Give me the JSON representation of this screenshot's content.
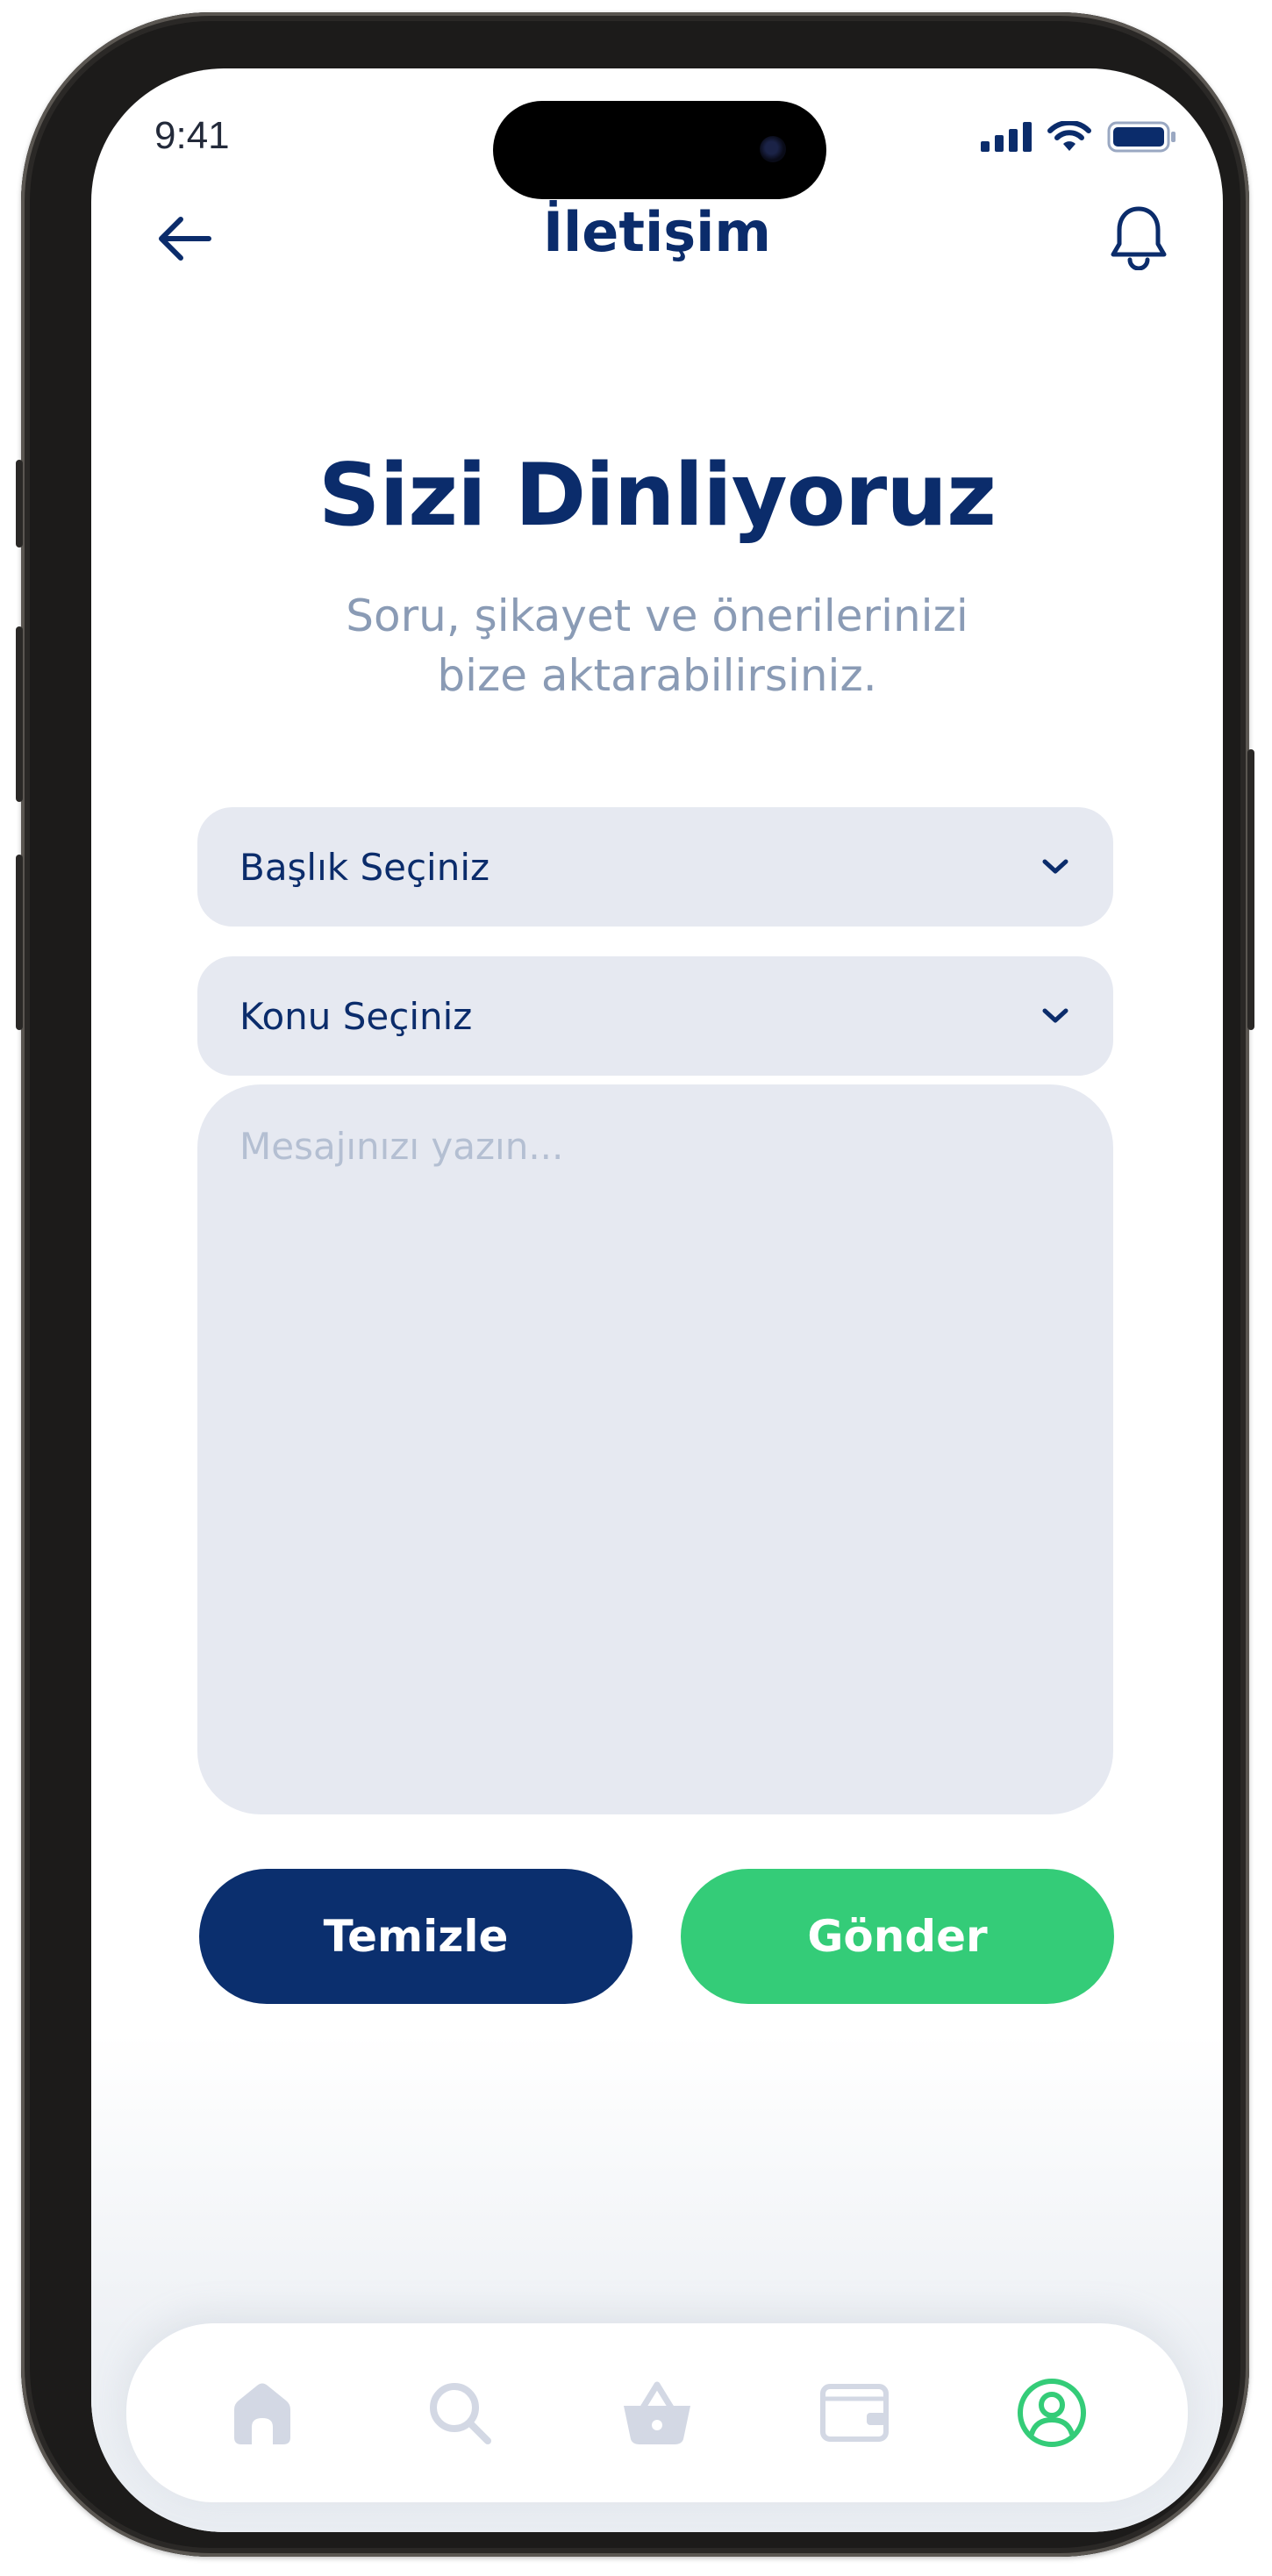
{
  "status_bar": {
    "time": "9:41"
  },
  "header": {
    "title": "İletişim"
  },
  "hero": {
    "title": "Sizi Dinliyoruz",
    "subtitle_line1": "Soru, şikayet ve önerilerinizi",
    "subtitle_line2": "bize aktarabilirsiniz."
  },
  "form": {
    "title_select": "Başlık Seçiniz",
    "topic_select": "Konu Seçiniz",
    "message_placeholder": "Mesajınızı yazın...",
    "clear_label": "Temizle",
    "send_label": "Gönder"
  },
  "colors": {
    "primary": "#0b2c6b",
    "accent_green": "#34cc78",
    "field_bg": "#e6e9f1",
    "muted_text": "#8a9bb5",
    "nav_inactive": "#d3d8e4"
  },
  "nav": {
    "items": [
      {
        "icon": "home-icon",
        "active": false
      },
      {
        "icon": "search-icon",
        "active": false
      },
      {
        "icon": "basket-icon",
        "active": false
      },
      {
        "icon": "wallet-icon",
        "active": false
      },
      {
        "icon": "profile-icon",
        "active": true
      }
    ]
  }
}
